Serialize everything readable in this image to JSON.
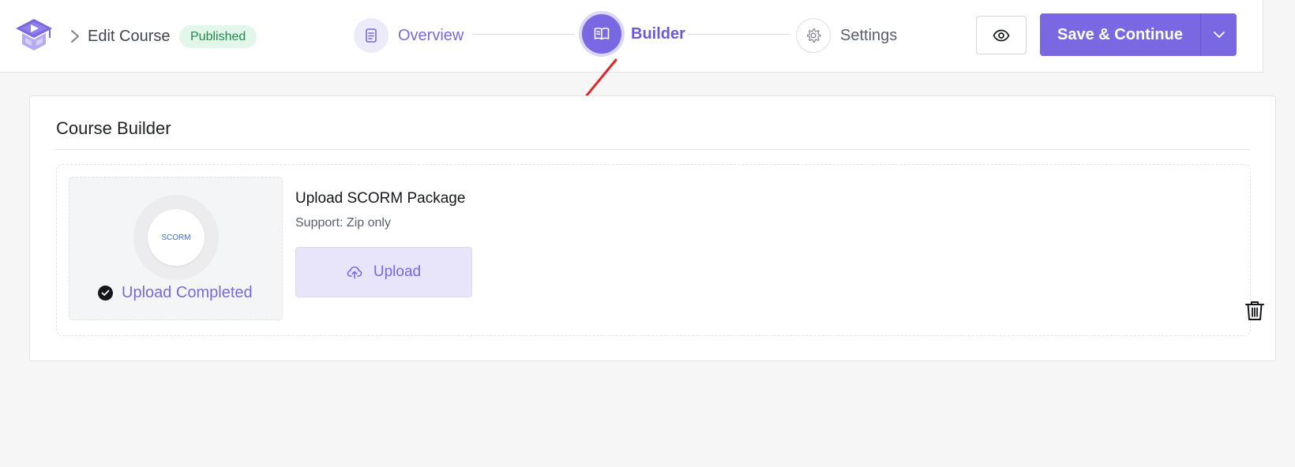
{
  "header": {
    "logo_icon": "graduation-cap-play-icon",
    "breadcrumb": {
      "title": "Edit Course",
      "status_badge": "Published"
    },
    "steps": [
      {
        "label": "Overview",
        "icon": "document-icon",
        "state": "completed"
      },
      {
        "label": "Builder",
        "icon": "open-book-icon",
        "state": "active"
      },
      {
        "label": "Settings",
        "icon": "gear-icon",
        "state": "upcoming"
      }
    ],
    "preview_icon": "eye-icon",
    "save_label": "Save & Continue",
    "save_dropdown_icon": "chevron-down-icon"
  },
  "main": {
    "title": "Course Builder",
    "scorm": {
      "thumb_label": "SCORM",
      "status": "Upload Completed",
      "package_title": "Upload SCORM Package",
      "support_text": "Support: Zip only",
      "upload_label": "Upload",
      "delete_icon": "trash-icon"
    }
  },
  "annotation": {
    "arrow_color": "#e02424"
  },
  "colors": {
    "accent": "#7a68e3",
    "badge_bg": "#e2f6e9",
    "badge_text": "#1e8a4a",
    "page_bg": "#f6f6f6"
  }
}
